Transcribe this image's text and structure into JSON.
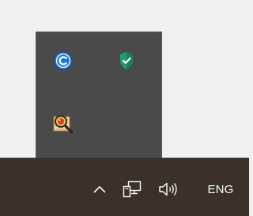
{
  "taskbar": {
    "language": "ENG",
    "background": "#3b3128"
  },
  "tray_overflow": {
    "background": "#4a4a4a",
    "icons": [
      {
        "name": "c-circle-app-icon",
        "color": "#1a73e8"
      },
      {
        "name": "shield-check-icon",
        "color": "#1f9e6e"
      },
      {
        "name": "magnifier-document-app-icon",
        "color": "#e8c13a"
      }
    ]
  },
  "system_icons": [
    {
      "name": "chevron-up-icon"
    },
    {
      "name": "network-icon"
    },
    {
      "name": "speaker-icon"
    }
  ]
}
